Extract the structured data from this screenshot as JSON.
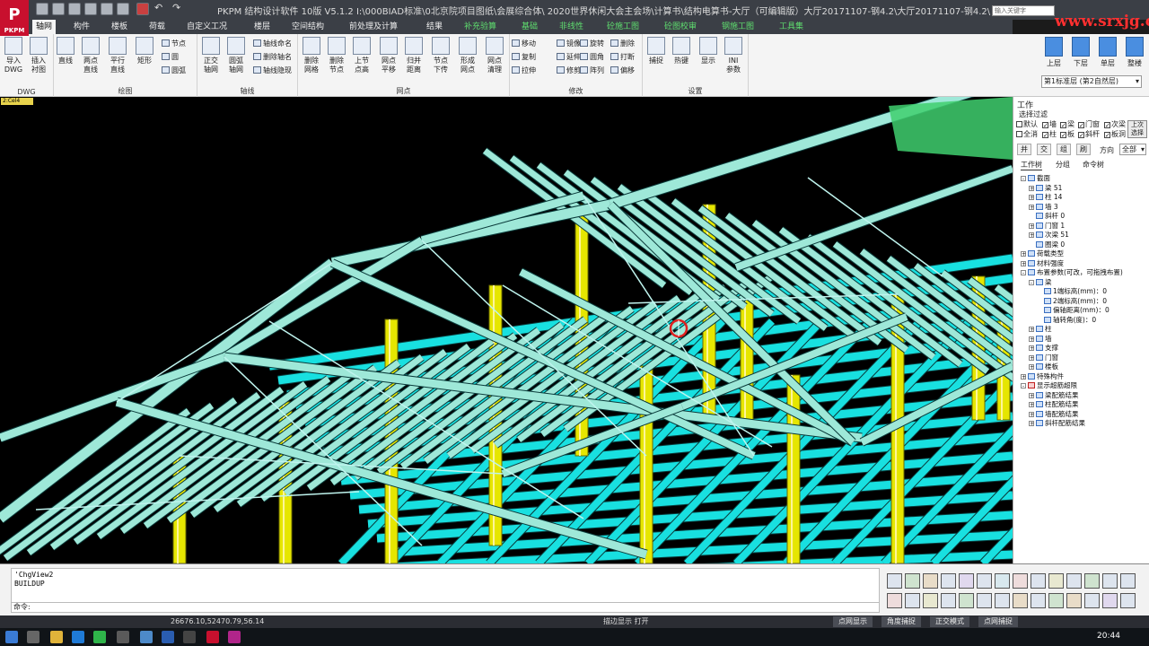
{
  "window": {
    "title": "PKPM 结构设计软件 10版 V5.1.2 I:\\000BIAD标准\\0北京院项目图纸\\会展综合体\\ 2020世界休闲大会主会场\\计算书\\结构电算书-大厅（可编辑版）大厅20171107-钢4.2\\大厅20171107-钢4.2\\",
    "logo": "PKPM",
    "search_placeholder": "输入关键字",
    "watermark": "www.srxjg.com"
  },
  "menu": {
    "tabs": [
      {
        "label": "轴网",
        "active": true
      },
      {
        "label": "构件"
      },
      {
        "label": "楼板"
      },
      {
        "label": "荷载"
      },
      {
        "label": "自定义工况"
      },
      {
        "label": "楼层"
      },
      {
        "label": "空间结构"
      },
      {
        "label": "前处理及计算"
      },
      {
        "label": "结果"
      },
      {
        "label": "补充验算",
        "green": true
      },
      {
        "label": "基础",
        "green": true
      },
      {
        "label": "非线性",
        "green": true
      },
      {
        "label": "砼施工图",
        "green": true
      },
      {
        "label": "砼图校审",
        "green": true
      },
      {
        "label": "钢施工图",
        "green": true
      },
      {
        "label": "工具集",
        "green": true
      }
    ]
  },
  "ribbon": {
    "dwg": {
      "label": "DWG",
      "import": "导入\nDWG",
      "insert": "插入\n衬图"
    },
    "draw": {
      "label": "绘图",
      "line": "直线",
      "two_point": "两点\n直线",
      "parallel": "平行\n直线",
      "rect": "矩形",
      "node": "节点",
      "circle": "圆",
      "arc": "圆弧"
    },
    "axis": {
      "label": "轴线",
      "ortho": "正交\n轴网",
      "arc_grid": "圆弧\n轴网",
      "axis_name": "轴线命名",
      "del_axis_name": "删除轴名",
      "axis_hide": "轴线隐现"
    },
    "grid": {
      "label": "网点",
      "del_grid": "删除\n网格",
      "del_node": "删除\n节点",
      "up_node": "上节\n点高",
      "node_move": "网点\n平移",
      "return": "归并\n距离",
      "node_down": "节点\n下传",
      "form_grid": "形成\n网点",
      "grid_clean": "网点\n清理"
    },
    "modify": {
      "label": "修改",
      "move": "移动",
      "copy": "复制",
      "stretch": "拉伸",
      "mirror": "镜像",
      "extend": "延伸",
      "trim": "修剪",
      "rotate": "旋转",
      "round": "圆角",
      "array": "阵列",
      "delete": "删除",
      "break": "打断",
      "offset": "偏移"
    },
    "settings": {
      "label": "设置",
      "snap": "捕捉",
      "hotkey": "热键",
      "display": "显示",
      "ini": "INI\n参数"
    },
    "floor": {
      "up": "上层",
      "down": "下层",
      "single": "单层",
      "whole": "整楼",
      "current": "第1标准层 (第2自然层)"
    }
  },
  "viewport": {
    "tag": "2:Cel4"
  },
  "panel": {
    "title": "工作",
    "filter_title": "选择过滤",
    "filters_row1": [
      {
        "label": "默认",
        "checked": false
      },
      {
        "label": "墙",
        "checked": true
      },
      {
        "label": "梁",
        "checked": true
      },
      {
        "label": "门窗",
        "checked": true
      },
      {
        "label": "次梁",
        "checked": true
      }
    ],
    "filters_row2": [
      {
        "label": "全消",
        "checked": false
      },
      {
        "label": "柱",
        "checked": true
      },
      {
        "label": "板",
        "checked": true
      },
      {
        "label": "斜杆",
        "checked": true
      },
      {
        "label": "板洞",
        "checked": true
      }
    ],
    "last_select": "上次\n选择",
    "ops": [
      "并",
      "交",
      "组",
      "刷"
    ],
    "direction_label": "方向",
    "direction_value": "全部",
    "tabs": [
      "工作树",
      "分组",
      "命令树"
    ],
    "tree": [
      {
        "level": 0,
        "text": "截面",
        "exp": "-"
      },
      {
        "level": 1,
        "text": "梁 51",
        "exp": "+"
      },
      {
        "level": 1,
        "text": "柱 14",
        "exp": "+"
      },
      {
        "level": 1,
        "text": "墙 3",
        "exp": "+"
      },
      {
        "level": 1,
        "text": "斜杆 0",
        "exp": ""
      },
      {
        "level": 1,
        "text": "门窗 1",
        "exp": "+"
      },
      {
        "level": 1,
        "text": "次梁 51",
        "exp": "+"
      },
      {
        "level": 1,
        "text": "圈梁 0",
        "exp": ""
      },
      {
        "level": 0,
        "text": "荷载类型",
        "exp": "+"
      },
      {
        "level": 0,
        "text": "材料强度",
        "exp": "+"
      },
      {
        "level": 0,
        "text": "布置参数(可改，可拖拽布置)",
        "exp": "-"
      },
      {
        "level": 1,
        "text": "梁",
        "exp": "-"
      },
      {
        "level": 2,
        "text": "1端标高(mm)：0",
        "exp": ""
      },
      {
        "level": 2,
        "text": "2端标高(mm)：0",
        "exp": ""
      },
      {
        "level": 2,
        "text": "偏轴距离(mm)：0",
        "exp": ""
      },
      {
        "level": 2,
        "text": "轴转角(度)：0",
        "exp": ""
      },
      {
        "level": 1,
        "text": "柱",
        "exp": "+"
      },
      {
        "level": 1,
        "text": "墙",
        "exp": "+"
      },
      {
        "level": 1,
        "text": "支撑",
        "exp": "+"
      },
      {
        "level": 1,
        "text": "门窗",
        "exp": "+"
      },
      {
        "level": 1,
        "text": "楼板",
        "exp": "+"
      },
      {
        "level": 0,
        "text": "特殊构件",
        "exp": "+"
      },
      {
        "level": 0,
        "text": "显示超筋超限",
        "exp": "-",
        "red": true
      },
      {
        "level": 1,
        "text": "梁配筋结果",
        "exp": "+"
      },
      {
        "level": 1,
        "text": "柱配筋结果",
        "exp": "+"
      },
      {
        "level": 1,
        "text": "墙配筋结果",
        "exp": "+"
      },
      {
        "level": 1,
        "text": "斜杆配筋结果",
        "exp": "+"
      }
    ]
  },
  "command": {
    "history": [
      "'ChgView2",
      "BUILDUP"
    ],
    "prompt": "命令:"
  },
  "status": {
    "coords": "26676.10,52470.79,56.14",
    "edge_display": "描边显示 打开",
    "buttons": [
      "点网显示",
      "角度捕捉",
      "正交模式",
      "点网捕捉"
    ]
  },
  "taskbar": {
    "time": "20:44"
  },
  "colors": {
    "beam": "#9ee8d8",
    "slab": "#18e0e0",
    "column": "#e6e600",
    "titlebar": "#3b3f46"
  }
}
